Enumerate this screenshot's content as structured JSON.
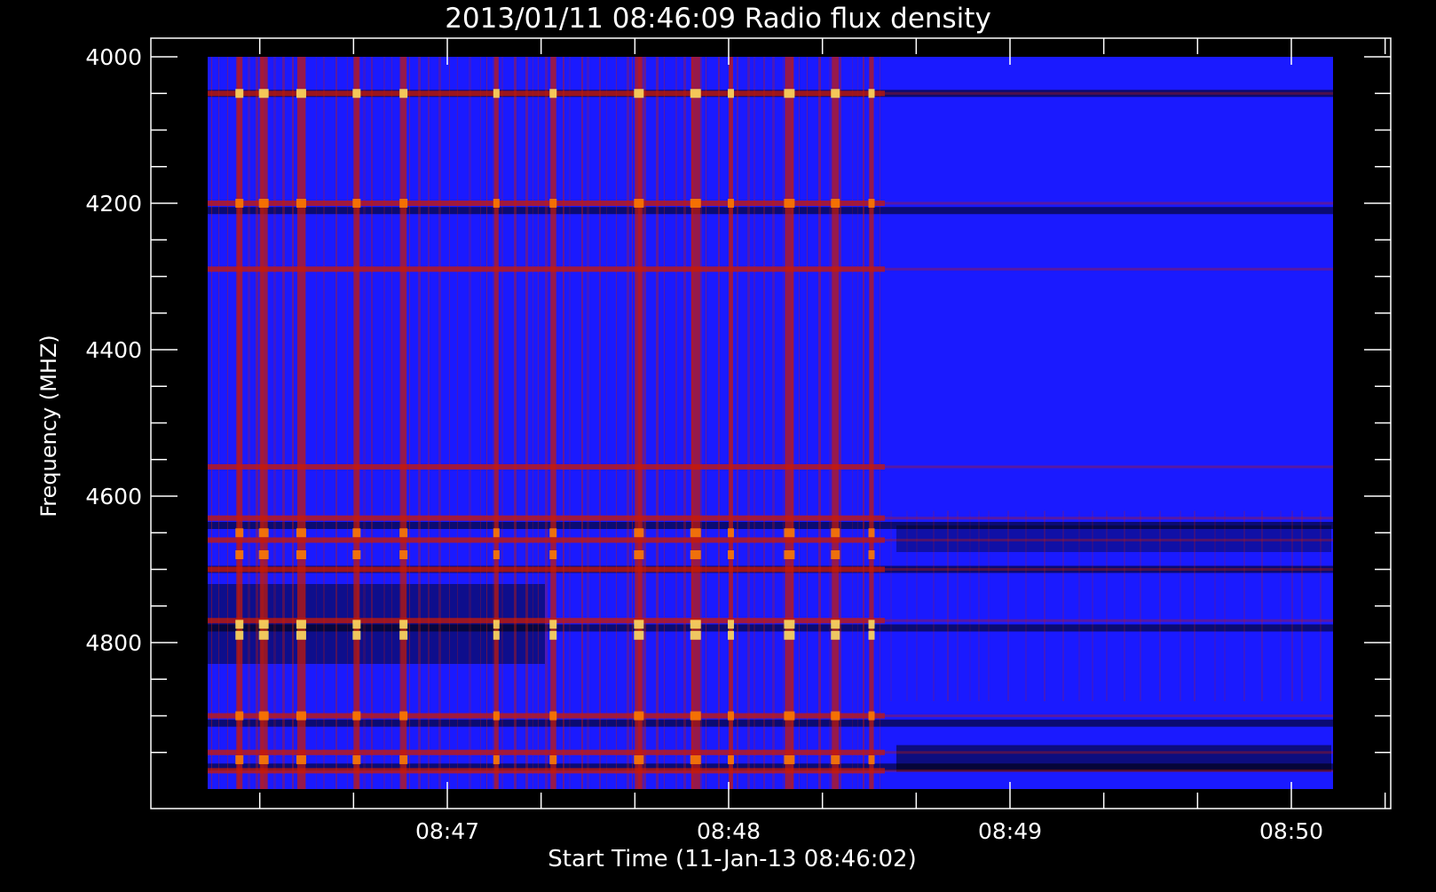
{
  "chart_data": {
    "type": "heatmap",
    "title": "2013/01/11 08:46:09 Radio flux density",
    "xlabel": "Start Time (11-Jan-13 08:46:02)",
    "ylabel": "Frequency (MHZ)",
    "ylim": [
      4000,
      5000
    ],
    "y_inverted": true,
    "y_ticks": [
      4000,
      4200,
      4400,
      4600,
      4800
    ],
    "y_tick_labels": [
      "4000",
      "4200",
      "4400",
      "4600",
      "4800"
    ],
    "x_ticks": [
      "08:47",
      "08:48",
      "08:49",
      "08:50"
    ],
    "colormap": [
      "#000000",
      "#1a1aff",
      "#cc1a00",
      "#ff8000",
      "#ffe666"
    ],
    "colors": {
      "background": "#000000",
      "axis": "#ffffff",
      "base": "#1a1aff"
    },
    "grid": false,
    "emission_bands_mhz": [
      4050,
      4200,
      4290,
      4560,
      4630,
      4660,
      4700,
      4770,
      4900,
      4950,
      4975
    ],
    "dark_bands_mhz": [
      4050,
      4210,
      4640,
      4700,
      4780,
      4910,
      4970
    ],
    "burst_times": [
      "08:46:15",
      "08:46:20",
      "08:46:28",
      "08:46:40",
      "08:46:50",
      "08:47:10",
      "08:47:22",
      "08:47:40",
      "08:47:52",
      "08:48:00",
      "08:48:12",
      "08:48:22",
      "08:48:30"
    ]
  }
}
